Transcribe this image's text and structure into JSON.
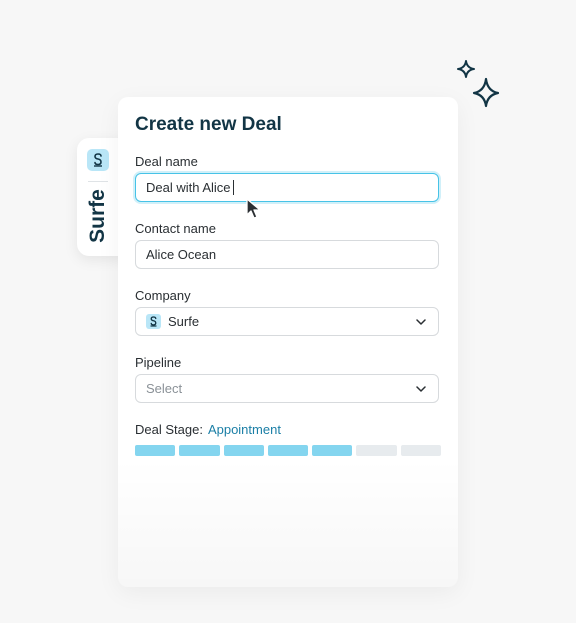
{
  "side_tab": {
    "brand": "Surfe"
  },
  "form": {
    "title": "Create new Deal",
    "deal_name": {
      "label": "Deal name",
      "value": "Deal with Alice"
    },
    "contact_name": {
      "label": "Contact name",
      "value": "Alice Ocean"
    },
    "company": {
      "label": "Company",
      "value": "Surfe",
      "icon": "surfe-logo-icon"
    },
    "pipeline": {
      "label": "Pipeline",
      "placeholder": "Select"
    },
    "deal_stage": {
      "label": "Deal Stage:",
      "value": "Appointment",
      "filled_segments": 5,
      "total_segments": 7
    }
  },
  "colors": {
    "accent": "#47c3e7",
    "stage_filled": "#84d5ef",
    "stage_empty": "#e7ebee",
    "title": "#123545",
    "stage_value": "#1b7fa6"
  }
}
